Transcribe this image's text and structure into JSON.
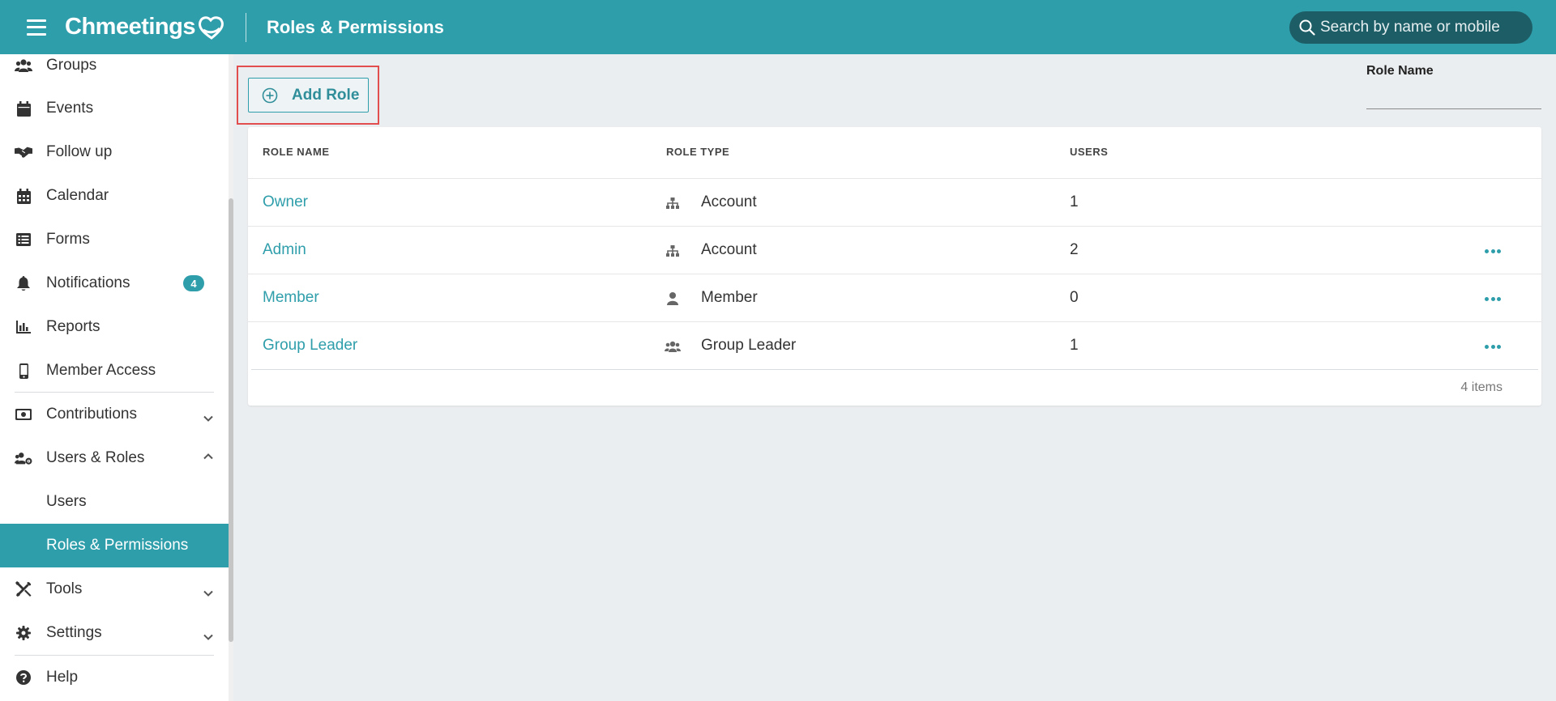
{
  "header": {
    "logo_text": "Chmeetings",
    "title": "Roles & Permissions",
    "search_placeholder": "Search by name or mobile"
  },
  "sidebar": {
    "items": [
      {
        "label": "Groups",
        "icon": "users-icon"
      },
      {
        "label": "Events",
        "icon": "calendar-icon"
      },
      {
        "label": "Follow up",
        "icon": "handshake-icon"
      },
      {
        "label": "Calendar",
        "icon": "calendar-grid-icon"
      },
      {
        "label": "Forms",
        "icon": "list-icon"
      },
      {
        "label": "Notifications",
        "icon": "bell-icon",
        "badge": "4"
      },
      {
        "label": "Reports",
        "icon": "chart-icon"
      },
      {
        "label": "Member Access",
        "icon": "mobile-icon"
      },
      {
        "label": "Contributions",
        "icon": "money-icon",
        "chevron": "down"
      },
      {
        "label": "Users & Roles",
        "icon": "users-cog-icon",
        "chevron": "up"
      },
      {
        "label": "Users"
      },
      {
        "label": "Roles & Permissions",
        "active": true
      },
      {
        "label": "Tools",
        "icon": "tools-icon",
        "chevron": "down"
      },
      {
        "label": "Settings",
        "icon": "gear-icon",
        "chevron": "down"
      },
      {
        "label": "Help",
        "icon": "question-icon"
      }
    ]
  },
  "toolbar": {
    "add_role_label": "Add Role"
  },
  "filter": {
    "label": "Role Name",
    "value": ""
  },
  "table": {
    "columns": [
      "ROLE NAME",
      "ROLE TYPE",
      "USERS"
    ],
    "rows": [
      {
        "name": "Owner",
        "type": "Account",
        "type_icon": "sitemap-icon",
        "users": "1",
        "has_menu": false
      },
      {
        "name": "Admin",
        "type": "Account",
        "type_icon": "sitemap-icon",
        "users": "2",
        "has_menu": true
      },
      {
        "name": "Member",
        "type": "Member",
        "type_icon": "user-icon",
        "users": "0",
        "has_menu": true
      },
      {
        "name": "Group Leader",
        "type": "Group Leader",
        "type_icon": "users-icon",
        "users": "1",
        "has_menu": true
      }
    ],
    "item_count": "4 items"
  },
  "colors": {
    "brand": "#2f9eab",
    "highlight": "#e24d4d"
  }
}
